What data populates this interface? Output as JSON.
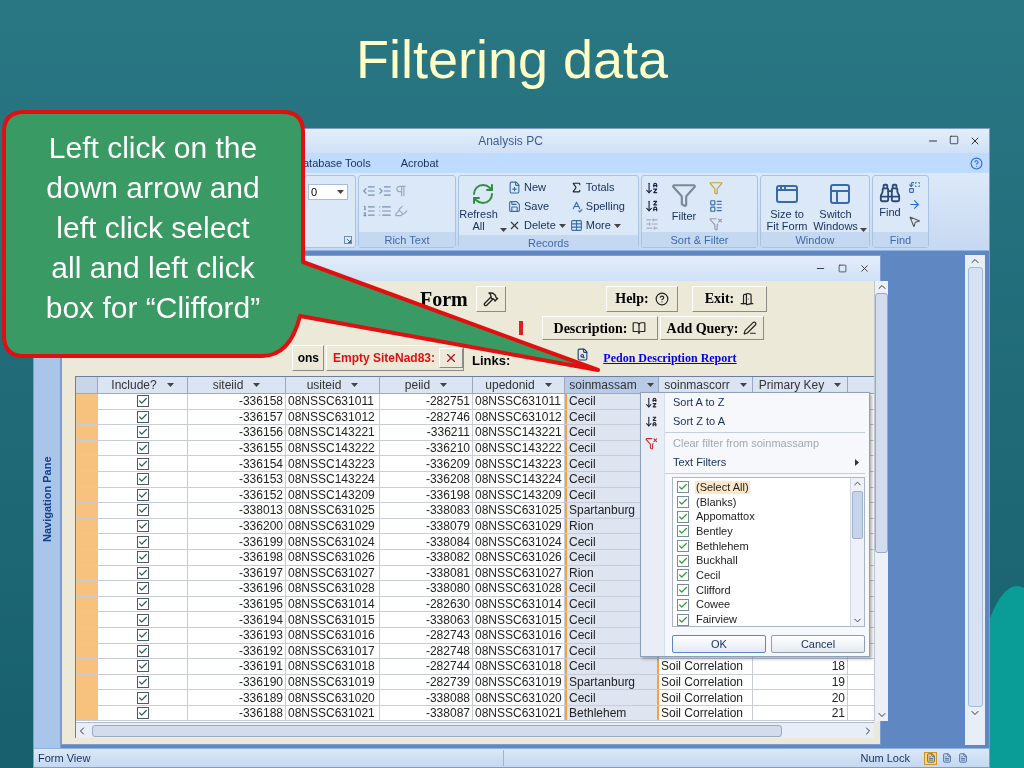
{
  "slide": {
    "title": "Filtering data"
  },
  "callout": {
    "lines": [
      "Left click on the",
      "down arrow and",
      "left click select",
      "all and left click",
      "box for “Clifford”"
    ]
  },
  "window": {
    "title": "Analysis PC"
  },
  "ribbon": {
    "tabs": [
      {
        "label": "atabase Tools",
        "selected": false
      },
      {
        "label": "Acrobat",
        "selected": false
      }
    ],
    "groups": [
      {
        "kind": "font",
        "value": "0"
      },
      {
        "kind": "rich_text",
        "label": "Rich Text"
      },
      {
        "kind": "records",
        "label": "Records",
        "items": [
          "Refresh All",
          "New",
          "Save",
          "Delete",
          "Totals",
          "Spelling",
          "More"
        ]
      },
      {
        "kind": "sort_filter",
        "label": "Sort & Filter",
        "items": [
          "Filter"
        ]
      },
      {
        "kind": "window",
        "label": "Window",
        "items": [
          "Size to Fit Form",
          "Switch Windows"
        ]
      },
      {
        "kind": "find",
        "label": "Find",
        "items": [
          "Find"
        ]
      }
    ]
  },
  "navigation_pane": {
    "label": "Navigation Pane"
  },
  "form": {
    "title": "Form",
    "help": "Help:",
    "exit": "Exit:",
    "description": "Description:",
    "add_query": "Add Query:",
    "options": "ons",
    "empty_sitenad": "Empty SiteNad83:",
    "links": "Links:",
    "report_link": "Pedon Description Report"
  },
  "datasheet": {
    "include_column": {
      "label": "Include?"
    },
    "columns": [
      {
        "label": "siteiid",
        "kind": "number",
        "selected": false
      },
      {
        "label": "usiteid",
        "kind": "text",
        "selected": false
      },
      {
        "label": "peiid",
        "kind": "number",
        "selected": false
      },
      {
        "label": "upedonid",
        "kind": "text",
        "selected": false
      },
      {
        "label": "soinmassam",
        "kind": "text",
        "selected": true
      },
      {
        "label": "soinmascorr",
        "kind": "text",
        "selected": false
      },
      {
        "label": "Primary Key",
        "kind": "number",
        "selected": false
      }
    ],
    "rows": [
      {
        "include": true,
        "cells": [
          "-336158",
          "08NSSC631011",
          "-282751",
          "08NSSC631011",
          "Cecil"
        ]
      },
      {
        "include": true,
        "cells": [
          "-336157",
          "08NSSC631012",
          "-282746",
          "08NSSC631012",
          "Cecil"
        ]
      },
      {
        "include": true,
        "cells": [
          "-336156",
          "08NSSC143221",
          "-336211",
          "08NSSC143221",
          "Cecil"
        ]
      },
      {
        "include": true,
        "cells": [
          "-336155",
          "08NSSC143222",
          "-336210",
          "08NSSC143222",
          "Cecil"
        ]
      },
      {
        "include": true,
        "cells": [
          "-336154",
          "08NSSC143223",
          "-336209",
          "08NSSC143223",
          "Cecil"
        ]
      },
      {
        "include": true,
        "cells": [
          "-336153",
          "08NSSC143224",
          "-336208",
          "08NSSC143224",
          "Cecil"
        ]
      },
      {
        "include": true,
        "cells": [
          "-336152",
          "08NSSC143209",
          "-336198",
          "08NSSC143209",
          "Cecil"
        ]
      },
      {
        "include": true,
        "cells": [
          "-338013",
          "08NSSC631025",
          "-338083",
          "08NSSC631025",
          "Spartanburg"
        ]
      },
      {
        "include": true,
        "cells": [
          "-336200",
          "08NSSC631029",
          "-338079",
          "08NSSC631029",
          "Rion"
        ]
      },
      {
        "include": true,
        "cells": [
          "-336199",
          "08NSSC631024",
          "-338084",
          "08NSSC631024",
          "Cecil"
        ]
      },
      {
        "include": true,
        "cells": [
          "-336198",
          "08NSSC631026",
          "-338082",
          "08NSSC631026",
          "Cecil"
        ]
      },
      {
        "include": true,
        "cells": [
          "-336197",
          "08NSSC631027",
          "-338081",
          "08NSSC631027",
          "Rion"
        ]
      },
      {
        "include": true,
        "cells": [
          "-336196",
          "08NSSC631028",
          "-338080",
          "08NSSC631028",
          "Cecil"
        ]
      },
      {
        "include": true,
        "cells": [
          "-336195",
          "08NSSC631014",
          "-282630",
          "08NSSC631014",
          "Cecil"
        ]
      },
      {
        "include": true,
        "cells": [
          "-336194",
          "08NSSC631015",
          "-338063",
          "08NSSC631015",
          "Cecil"
        ]
      },
      {
        "include": true,
        "cells": [
          "-336193",
          "08NSSC631016",
          "-282743",
          "08NSSC631016",
          "Cecil"
        ]
      },
      {
        "include": true,
        "cells": [
          "-336192",
          "08NSSC631017",
          "-282748",
          "08NSSC631017",
          "Cecil"
        ]
      },
      {
        "include": true,
        "cells": [
          "-336191",
          "08NSSC631018",
          "-282744",
          "08NSSC631018",
          "Cecil",
          "Soil Correlation",
          "18"
        ]
      },
      {
        "include": true,
        "cells": [
          "-336190",
          "08NSSC631019",
          "-282739",
          "08NSSC631019",
          "Spartanburg",
          "Soil Correlation",
          "19"
        ]
      },
      {
        "include": true,
        "cells": [
          "-336189",
          "08NSSC631020",
          "-338088",
          "08NSSC631020",
          "Cecil",
          "Soil Correlation",
          "20"
        ]
      },
      {
        "include": true,
        "cells": [
          "-336188",
          "08NSSC631021",
          "-338087",
          "08NSSC631021",
          "Bethlehem",
          "Soil Correlation",
          "21"
        ]
      }
    ]
  },
  "filter_menu": {
    "items": [
      {
        "label": "Sort A to Z",
        "kind": "sort_asc",
        "disabled": false
      },
      {
        "label": "Sort Z to A",
        "kind": "sort_desc",
        "disabled": false
      },
      {
        "label": "Clear filter from soinmassamp",
        "kind": "clear",
        "disabled": true
      },
      {
        "label": "Text Filters",
        "kind": "submenu",
        "disabled": false
      }
    ],
    "values": [
      {
        "label": "(Select All)",
        "checked": true,
        "selected": true
      },
      {
        "label": "(Blanks)",
        "checked": true,
        "selected": false
      },
      {
        "label": "Appomattox",
        "checked": true,
        "selected": false
      },
      {
        "label": "Bentley",
        "checked": true,
        "selected": false
      },
      {
        "label": "Bethlehem",
        "checked": true,
        "selected": false
      },
      {
        "label": "Buckhall",
        "checked": true,
        "selected": false
      },
      {
        "label": "Cecil",
        "checked": true,
        "selected": false
      },
      {
        "label": "Clifford",
        "checked": true,
        "selected": false
      },
      {
        "label": "Cowee",
        "checked": true,
        "selected": false
      },
      {
        "label": "Fairview",
        "checked": true,
        "selected": false
      }
    ],
    "buttons": [
      "OK",
      "Cancel"
    ]
  },
  "status_bar": {
    "left": "Form View",
    "right": "Num Lock",
    "views": [
      {
        "selected": true
      },
      {
        "selected": false
      },
      {
        "selected": false
      }
    ]
  }
}
